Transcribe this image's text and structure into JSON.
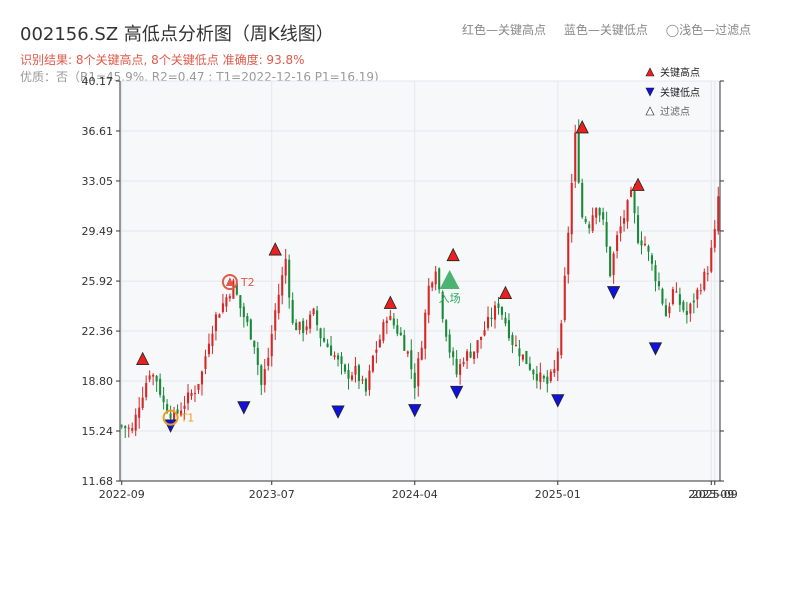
{
  "title": "002156.SZ 高低点分析图（周K线图）",
  "subtitle": {
    "line1": "识别结果: 8个关键高点, 8个关键低点  准确度: 93.8%",
    "line2": "优质：否（R1=45.9%, R2=0.47 ; T1=2022-12-16 P1=16.19)"
  },
  "top_legend": [
    "红色—关键高点",
    "蓝色—关键低点",
    "◯浅色—过滤点"
  ],
  "colors": {
    "up": "#d62728",
    "down": "#1a8a3a",
    "high_marker": "#e82020",
    "low_marker": "#1111dd",
    "t1": "#e8a020",
    "t2": "#e05a4a",
    "entry": "#2ea85a",
    "plot_bg": "#f6f8fa"
  },
  "chart_data": {
    "type": "candlestick",
    "y_ticks": [
      11.68,
      15.24,
      18.8,
      22.36,
      25.92,
      29.49,
      33.05,
      36.61,
      40.17
    ],
    "y_tick_labels": [
      "11.68",
      "15.24",
      "18.80",
      "22.36",
      "25.92",
      "29.49",
      "33.05",
      "36.61",
      "40.17"
    ],
    "ylim": [
      11.68,
      40.17
    ],
    "x_ticks": [
      {
        "label": "2022-09",
        "week": 0
      },
      {
        "label": "2023-07",
        "week": 43
      },
      {
        "label": "2024-04",
        "week": 84
      },
      {
        "label": "2025-01",
        "week": 125
      },
      {
        "label": "2025-09",
        "week": 169
      },
      {
        "label": "2025-09",
        "week": 170
      }
    ],
    "n_weeks": 172,
    "anchors": [
      [
        0,
        15.6
      ],
      [
        3,
        15.3
      ],
      [
        5,
        17.2
      ],
      [
        8,
        19.5
      ],
      [
        10,
        18.9
      ],
      [
        12,
        17.2
      ],
      [
        15,
        16.2
      ],
      [
        17,
        16.9
      ],
      [
        19,
        17.6
      ],
      [
        21,
        18.2
      ],
      [
        23,
        19.4
      ],
      [
        25,
        21.8
      ],
      [
        27,
        23.4
      ],
      [
        29,
        24.3
      ],
      [
        32,
        25.7
      ],
      [
        34,
        24.0
      ],
      [
        36,
        22.8
      ],
      [
        38,
        21.5
      ],
      [
        40,
        18.5
      ],
      [
        42,
        20.5
      ],
      [
        44,
        23.8
      ],
      [
        46,
        26.2
      ],
      [
        47,
        27.5
      ],
      [
        49,
        22.8
      ],
      [
        52,
        22.5
      ],
      [
        55,
        23.6
      ],
      [
        57,
        22.0
      ],
      [
        59,
        21.3
      ],
      [
        61,
        20.6
      ],
      [
        64,
        19.2
      ],
      [
        67,
        19.5
      ],
      [
        70,
        18.0
      ],
      [
        72,
        20.5
      ],
      [
        74,
        21.8
      ],
      [
        76,
        23.5
      ],
      [
        78,
        22.8
      ],
      [
        80,
        22.0
      ],
      [
        82,
        20.8
      ],
      [
        84,
        18.6
      ],
      [
        86,
        21.6
      ],
      [
        88,
        25.5
      ],
      [
        90,
        27.0
      ],
      [
        92,
        23.6
      ],
      [
        94,
        21.0
      ],
      [
        96,
        19.3
      ],
      [
        98,
        20.5
      ],
      [
        101,
        21.0
      ],
      [
        104,
        22.5
      ],
      [
        106,
        23.4
      ],
      [
        108,
        24.3
      ],
      [
        110,
        23.0
      ],
      [
        112,
        21.6
      ],
      [
        114,
        20.9
      ],
      [
        116,
        20.2
      ],
      [
        118,
        19.5
      ],
      [
        120,
        19.0
      ],
      [
        122,
        18.6
      ],
      [
        124,
        19.5
      ],
      [
        126,
        22.5
      ],
      [
        128,
        29.5
      ],
      [
        130,
        36.2
      ],
      [
        132,
        30.5
      ],
      [
        134,
        30.0
      ],
      [
        136,
        31.5
      ],
      [
        138,
        30.0
      ],
      [
        140,
        26.5
      ],
      [
        142,
        29.0
      ],
      [
        144,
        30.5
      ],
      [
        146,
        32.0
      ],
      [
        148,
        29.0
      ],
      [
        150,
        28.6
      ],
      [
        152,
        27.0
      ],
      [
        154,
        25.5
      ],
      [
        156,
        23.5
      ],
      [
        158,
        25.2
      ],
      [
        160,
        24.3
      ],
      [
        162,
        23.5
      ],
      [
        164,
        24.6
      ],
      [
        166,
        25.7
      ],
      [
        168,
        26.8
      ],
      [
        170,
        29.3
      ],
      [
        172,
        34.5
      ]
    ],
    "key_highs": [
      {
        "week": 6,
        "price": 19.9
      },
      {
        "week": 44,
        "price": 27.7
      },
      {
        "week": 77,
        "price": 23.9
      },
      {
        "week": 95,
        "price": 27.3
      },
      {
        "week": 110,
        "price": 24.6
      },
      {
        "week": 132,
        "price": 36.4
      },
      {
        "week": 148,
        "price": 32.3
      }
    ],
    "key_lows": [
      {
        "week": 14,
        "price": 16.1
      },
      {
        "week": 35,
        "price": 17.4
      },
      {
        "week": 62,
        "price": 17.1
      },
      {
        "week": 84,
        "price": 17.2
      },
      {
        "week": 96,
        "price": 18.5
      },
      {
        "week": 125,
        "price": 17.9
      },
      {
        "week": 141,
        "price": 25.6
      },
      {
        "week": 153,
        "price": 21.6
      }
    ],
    "t1": {
      "label": "T1",
      "week": 14,
      "price": 16.19
    },
    "t2": {
      "label": "T2",
      "week": 31,
      "price": 25.85
    },
    "entry": {
      "label": "入场",
      "week": 94,
      "price": 26.0
    },
    "legend": [
      "关键高点",
      "关键低点",
      "过滤点"
    ]
  }
}
